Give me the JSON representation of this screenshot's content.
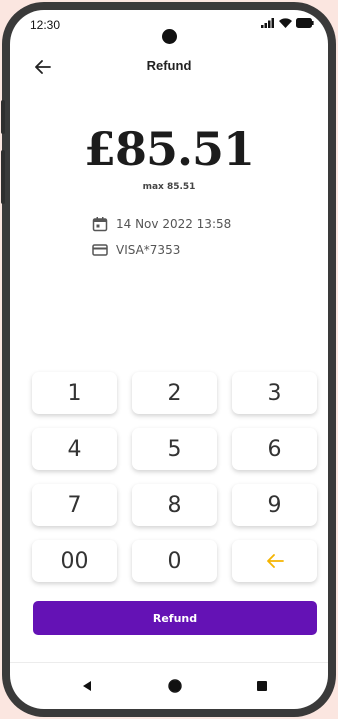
{
  "status": {
    "time": "12:30"
  },
  "header": {
    "title": "Refund",
    "back_icon": "arrow-left-icon"
  },
  "amount": {
    "value": "£85.51",
    "max_label": "max 85.51"
  },
  "details": {
    "date": "14 Nov 2022 13:58",
    "card": "VISA*7353"
  },
  "keypad": {
    "keys": [
      "1",
      "2",
      "3",
      "4",
      "5",
      "6",
      "7",
      "8",
      "9",
      "00",
      "0"
    ],
    "backspace_icon": "arrow-left-icon",
    "backspace_color": "#f5b400"
  },
  "action": {
    "refund_label": "Refund",
    "color": "#6412b5"
  },
  "navbar": {
    "icons": [
      "back-triangle-icon",
      "home-circle-icon",
      "recents-square-icon"
    ]
  }
}
